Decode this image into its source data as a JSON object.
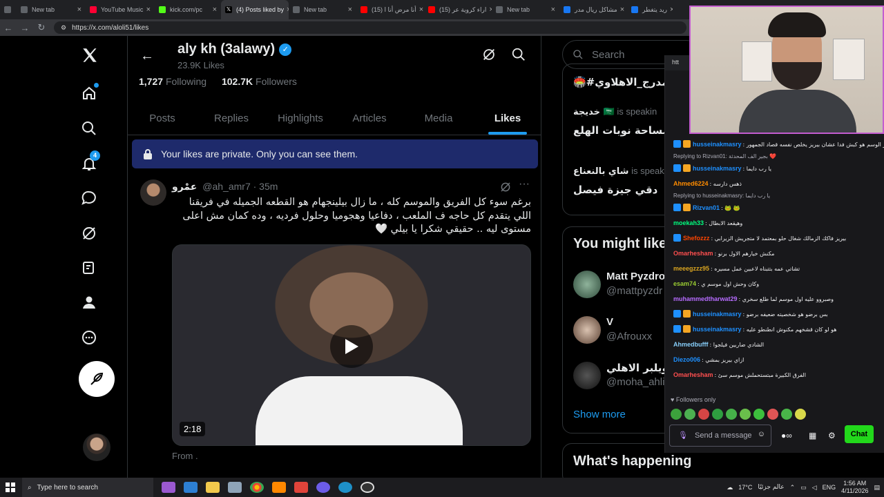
{
  "browser": {
    "tabs": [
      {
        "label": "",
        "icon": "window-icon",
        "color": "#5f6368"
      },
      {
        "label": "New tab",
        "icon": "tab-icon",
        "color": "#5f6368"
      },
      {
        "label": "YouTube Music",
        "icon": "youtube-music-icon",
        "color": "#ff0033"
      },
      {
        "label": "kick.com/pc",
        "icon": "kick-icon",
        "color": "#53fc18"
      },
      {
        "label": "(4) Posts liked by",
        "icon": "x-icon",
        "color": "#000000"
      },
      {
        "label": "New tab",
        "icon": "tab-icon",
        "color": "#5f6368"
      },
      {
        "label": "(15) أنا مرض أنا ا",
        "icon": "youtube-icon",
        "color": "#ff0000"
      },
      {
        "label": "(15) اراء كروية عر",
        "icon": "youtube-icon",
        "color": "#ff0000"
      },
      {
        "label": "New tab",
        "icon": "tab-icon",
        "color": "#5f6368"
      },
      {
        "label": "مشاكل ريال مدر",
        "icon": "facebook-icon",
        "color": "#1877f2"
      },
      {
        "label": "ريد يتغطر",
        "icon": "facebook-icon",
        "color": "#1877f2"
      }
    ],
    "url": "https://x.com/aloli51/likes"
  },
  "nav": {
    "notifications_count": "4"
  },
  "profile": {
    "name": "aly kh (3alawy)",
    "likes": "23.9K Likes",
    "following_count": "1,727",
    "following_label": "Following",
    "followers_count": "102.7K",
    "followers_label": "Followers"
  },
  "tabs": [
    "Posts",
    "Replies",
    "Highlights",
    "Articles",
    "Media",
    "Likes"
  ],
  "selected_tab": "Likes",
  "privacy_notice": "Your likes are private. Only you can see them.",
  "tweet": {
    "author": "عمْرو",
    "handle": "@ah_amr7",
    "time": "· 35m",
    "text": "برغم سوء كل الفريق والموسم كله ، ما زال بيلينجهام هو القطعه الجميله في فريقنا اللي يتقدم كل حاجه ف الملعب ، دفاعيا وهجوميا وحلول فرديه ، وده كمان مش اعلى مستوى ليه .. حقيقي شكرا يا بيلي 🤍",
    "video_duration": "2:18",
    "from_label": "From ."
  },
  "right": {
    "search_placeholder": "Search",
    "spaces": [
      {
        "title": "المدرج_الاهلاوي#🏟️"
      },
      {
        "host": "خديجة 🇸🇦",
        "status": "is speakin",
        "title": "مساحة نوبات الهلع"
      },
      {
        "host": "شاي بالنعناع",
        "status": "is speakin",
        "title": "دقي جيزة فيصل"
      }
    ],
    "you_might_like": "You might like",
    "suggestions": [
      {
        "name": "Matt Pyzdro",
        "handle": "@mattpyzdr"
      },
      {
        "name": "V",
        "handle": "@Afrouxx"
      },
      {
        "name": "ويلبر الاهلي",
        "handle": "@moha_ahli"
      }
    ],
    "show_more": "Show more",
    "whats_happening": "What's happening"
  },
  "chat": {
    "url_stub": "htt",
    "messages": [
      {
        "user": "husseinakmasry",
        "color": "#1e90ff",
        "badges": 2,
        "text": ": من الاخر الوسم هو كبش فدا عشان بيريز يخلص نفسه قصاد الجمهور"
      },
      {
        "reply": "Replying to Rizvan01: بجير الف المحدثة ❤️"
      },
      {
        "user": "husseinakmasry",
        "color": "#1e90ff",
        "badges": 2,
        "text": ": يا رب دايما"
      },
      {
        "user": "Ahmed6224",
        "color": "#ff8c00",
        "badges": 0,
        "text": ": ذهس دارسه"
      },
      {
        "reply": "Replying to husseinakmasry: يا رب دايما"
      },
      {
        "user": "Rizvan01",
        "color": "#1e90ff",
        "badges": 2,
        "text": ": 🐸 🐸"
      },
      {
        "user": "moekah33",
        "color": "#00ff7f",
        "badges": 0,
        "text": ": وهيقعد الابطال"
      },
      {
        "user": "Shefozzz",
        "color": "#ff4500",
        "badges": 1,
        "text": ": بيريز فاكك الزمالك شغال حلو بمعتمد لا متجريش الزيرابي"
      },
      {
        "user": "Omarhesham",
        "color": "#ff4f4f",
        "badges": 0,
        "text": ": مكنش خيارهم الاول برنو"
      },
      {
        "user": "meeegzzz95",
        "color": "#daa520",
        "badges": 0,
        "text": ": تشاتي عمه بتتبناه لاعبين عمل مسيره"
      },
      {
        "user": "esam74",
        "color": "#9acd32",
        "badges": 0,
        "text": ": وكان وحش اول موسم ي"
      },
      {
        "user": "muhammedtharwat29",
        "color": "#b76cff",
        "badges": 0,
        "text": ": وصبروو عليه اول موسم لما طلع سخري"
      },
      {
        "user": "husseinakmasry",
        "color": "#1e90ff",
        "badges": 2,
        "text": ": بس برضو هو شخصيته ضعيفه برضو"
      },
      {
        "user": "husseinakmasry",
        "color": "#1e90ff",
        "badges": 2,
        "text": ": هو لو كان قشخهم مكنوش انطنطو عليه"
      },
      {
        "user": "Ahmedbufff",
        "color": "#87cefa",
        "badges": 0,
        "text": ": الشادي ضاريين فيلجوا"
      },
      {
        "user": "Diezo006",
        "color": "#1e90ff",
        "badges": 0,
        "text": ": ازاي بيريز بمشي"
      },
      {
        "user": "Omarhesham",
        "color": "#ff4f4f",
        "badges": 0,
        "text": ": الفرق الكبيرة مبتستحملش موسم سئ"
      }
    ],
    "followers_only": "Followers only",
    "input_placeholder": "Send a message",
    "send_label": "Chat"
  },
  "taskbar": {
    "search_placeholder": "Type here to search",
    "weather": "17°C",
    "weather_label": "عالم جزئيًا",
    "lang": "ENG",
    "time": "1:56 AM",
    "date": "4/11/2026"
  }
}
